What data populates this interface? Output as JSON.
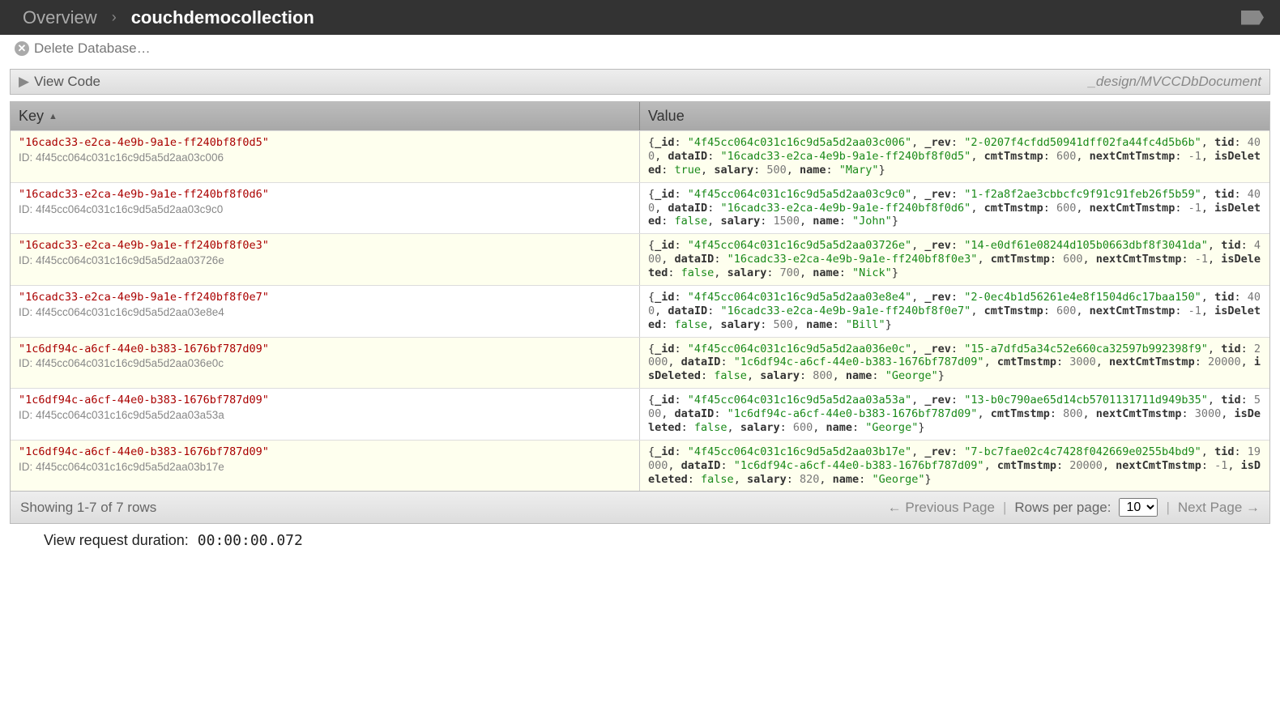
{
  "breadcrumb": {
    "overview": "Overview",
    "current": "couchdemocollection"
  },
  "toolbar": {
    "delete_label": "Delete Database…"
  },
  "viewcode": {
    "label": "View Code",
    "design_doc": "_design/MVCCDbDocument"
  },
  "columns": {
    "key": "Key",
    "value": "Value"
  },
  "rows": [
    {
      "key": "\"16cadc33-e2ca-4e9b-9a1e-ff240bf8f0d5\"",
      "id_label": "ID: 4f45cc064c031c16c9d5a5d2aa03c006",
      "doc": {
        "_id": "4f45cc064c031c16c9d5a5d2aa03c006",
        "_rev": "2-0207f4cfdd50941dff02fa44fc4d5b6b",
        "tid": 400,
        "dataID": "16cadc33-e2ca-4e9b-9a1e-ff240bf8f0d5",
        "cmtTmstmp": 600,
        "nextCmtTmstmp": -1,
        "isDeleted": true,
        "salary": 500,
        "name": "Mary"
      }
    },
    {
      "key": "\"16cadc33-e2ca-4e9b-9a1e-ff240bf8f0d6\"",
      "id_label": "ID: 4f45cc064c031c16c9d5a5d2aa03c9c0",
      "doc": {
        "_id": "4f45cc064c031c16c9d5a5d2aa03c9c0",
        "_rev": "1-f2a8f2ae3cbbcfc9f91c91feb26f5b59",
        "tid": 400,
        "dataID": "16cadc33-e2ca-4e9b-9a1e-ff240bf8f0d6",
        "cmtTmstmp": 600,
        "nextCmtTmstmp": -1,
        "isDeleted": false,
        "salary": 1500,
        "name": "John"
      }
    },
    {
      "key": "\"16cadc33-e2ca-4e9b-9a1e-ff240bf8f0e3\"",
      "id_label": "ID: 4f45cc064c031c16c9d5a5d2aa03726e",
      "doc": {
        "_id": "4f45cc064c031c16c9d5a5d2aa03726e",
        "_rev": "14-e0df61e08244d105b0663dbf8f3041da",
        "tid": 400,
        "dataID": "16cadc33-e2ca-4e9b-9a1e-ff240bf8f0e3",
        "cmtTmstmp": 600,
        "nextCmtTmstmp": -1,
        "isDeleted": false,
        "salary": 700,
        "name": "Nick"
      }
    },
    {
      "key": "\"16cadc33-e2ca-4e9b-9a1e-ff240bf8f0e7\"",
      "id_label": "ID: 4f45cc064c031c16c9d5a5d2aa03e8e4",
      "doc": {
        "_id": "4f45cc064c031c16c9d5a5d2aa03e8e4",
        "_rev": "2-0ec4b1d56261e4e8f1504d6c17baa150",
        "tid": 400,
        "dataID": "16cadc33-e2ca-4e9b-9a1e-ff240bf8f0e7",
        "cmtTmstmp": 600,
        "nextCmtTmstmp": -1,
        "isDeleted": false,
        "salary": 500,
        "name": "Bill"
      }
    },
    {
      "key": "\"1c6df94c-a6cf-44e0-b383-1676bf787d09\"",
      "id_label": "ID: 4f45cc064c031c16c9d5a5d2aa036e0c",
      "doc": {
        "_id": "4f45cc064c031c16c9d5a5d2aa036e0c",
        "_rev": "15-a7dfd5a34c52e660ca32597b992398f9",
        "tid": 2000,
        "dataID": "1c6df94c-a6cf-44e0-b383-1676bf787d09",
        "cmtTmstmp": 3000,
        "nextCmtTmstmp": 20000,
        "isDeleted": false,
        "salary": 800,
        "name": "George"
      }
    },
    {
      "key": "\"1c6df94c-a6cf-44e0-b383-1676bf787d09\"",
      "id_label": "ID: 4f45cc064c031c16c9d5a5d2aa03a53a",
      "doc": {
        "_id": "4f45cc064c031c16c9d5a5d2aa03a53a",
        "_rev": "13-b0c790ae65d14cb5701131711d949b35",
        "tid": 500,
        "dataID": "1c6df94c-a6cf-44e0-b383-1676bf787d09",
        "cmtTmstmp": 800,
        "nextCmtTmstmp": 3000,
        "isDeleted": false,
        "salary": 600,
        "name": "George"
      }
    },
    {
      "key": "\"1c6df94c-a6cf-44e0-b383-1676bf787d09\"",
      "id_label": "ID: 4f45cc064c031c16c9d5a5d2aa03b17e",
      "doc": {
        "_id": "4f45cc064c031c16c9d5a5d2aa03b17e",
        "_rev": "7-bc7fae02c4c7428f042669e0255b4bd9",
        "tid": 19000,
        "dataID": "1c6df94c-a6cf-44e0-b383-1676bf787d09",
        "cmtTmstmp": 20000,
        "nextCmtTmstmp": -1,
        "isDeleted": false,
        "salary": 820,
        "name": "George"
      }
    }
  ],
  "footer": {
    "showing": "Showing 1-7 of 7 rows",
    "prev": "← Previous Page",
    "rows_per_page_label": "Rows per page:",
    "rows_per_page_value": "10",
    "next": "Next Page →"
  },
  "duration": {
    "label": "View request duration:",
    "value": "00:00:00.072"
  }
}
